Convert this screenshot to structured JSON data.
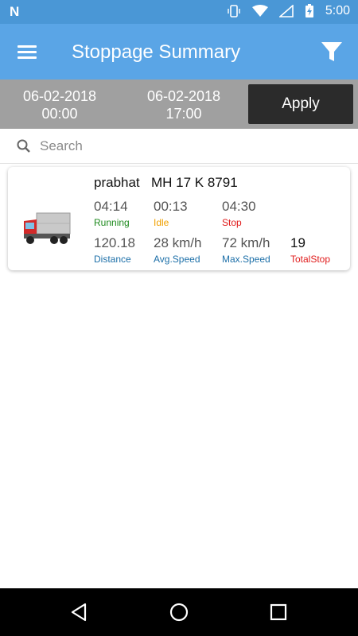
{
  "status_bar": {
    "time": "5:00",
    "icons": [
      "vibrate-icon",
      "wifi-icon",
      "signal-icon",
      "battery-charging-icon"
    ]
  },
  "app_bar": {
    "title": "Stoppage Summary",
    "menu_icon": "menu-icon",
    "filter_icon": "filter-icon"
  },
  "date_range": {
    "from_date": "06-02-2018",
    "from_time": "00:00",
    "to_date": "06-02-2018",
    "to_time": "17:00",
    "apply_label": "Apply"
  },
  "search": {
    "placeholder": "Search",
    "value": ""
  },
  "colors": {
    "primary": "#5aa5e6",
    "status_bar": "#4a97d6",
    "running": "#1e8a1e",
    "idle": "#f0a000",
    "stop": "#e01b1b",
    "metric_label": "#1c6fa8"
  },
  "vehicles": [
    {
      "driver": "prabhat",
      "plate": "MH 17 K 8791",
      "running": {
        "value": "04:14",
        "label": "Running"
      },
      "idle": {
        "value": "00:13",
        "label": "Idle"
      },
      "stop": {
        "value": "04:30",
        "label": "Stop"
      },
      "distance": {
        "value": "120.18",
        "label": "Distance"
      },
      "avg_speed": {
        "value": "28 km/h",
        "label": "Avg.Speed"
      },
      "max_speed": {
        "value": "72 km/h",
        "label": "Max.Speed"
      },
      "total_stop": {
        "value": "19",
        "label": "TotalStop"
      }
    }
  ],
  "nav": {
    "back": "back-icon",
    "home": "home-icon",
    "recents": "recents-icon"
  }
}
